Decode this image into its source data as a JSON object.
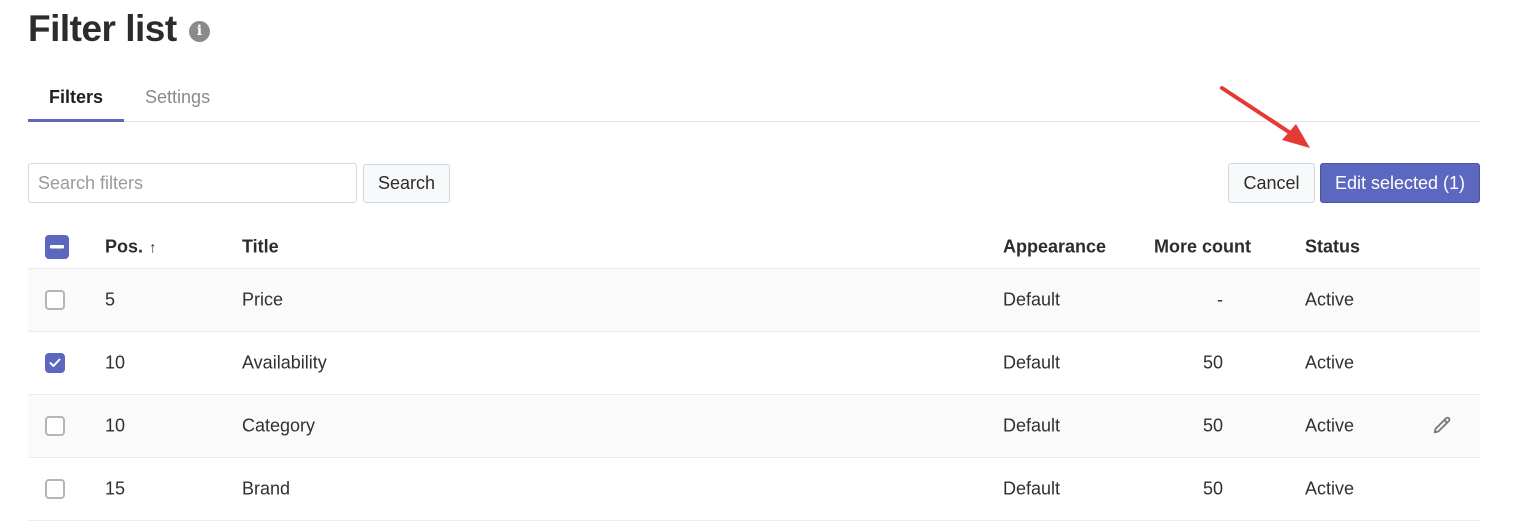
{
  "header": {
    "title": "Filter list",
    "info_icon": "info-icon"
  },
  "tabs": [
    {
      "label": "Filters",
      "active": true
    },
    {
      "label": "Settings",
      "active": false
    }
  ],
  "toolbar": {
    "search_placeholder": "Search filters",
    "search_value": "",
    "search_label": "Search",
    "cancel_label": "Cancel",
    "edit_selected_label": "Edit selected (1)"
  },
  "table": {
    "select_all_state": "indeterminate",
    "columns": {
      "pos": "Pos.",
      "pos_sort_icon": "↑",
      "title": "Title",
      "appearance": "Appearance",
      "more_count": "More count",
      "status": "Status"
    },
    "rows": [
      {
        "checked": false,
        "pos": "5",
        "title": "Price",
        "appearance": "Default",
        "more_count": "-",
        "status": "Active",
        "show_edit": false
      },
      {
        "checked": true,
        "pos": "10",
        "title": "Availability",
        "appearance": "Default",
        "more_count": "50",
        "status": "Active",
        "show_edit": false
      },
      {
        "checked": false,
        "pos": "10",
        "title": "Category",
        "appearance": "Default",
        "more_count": "50",
        "status": "Active",
        "show_edit": true
      },
      {
        "checked": false,
        "pos": "15",
        "title": "Brand",
        "appearance": "Default",
        "more_count": "50",
        "status": "Active",
        "show_edit": false
      }
    ]
  },
  "colors": {
    "accent": "#5c67c0",
    "annotation_arrow": "#e53935"
  }
}
